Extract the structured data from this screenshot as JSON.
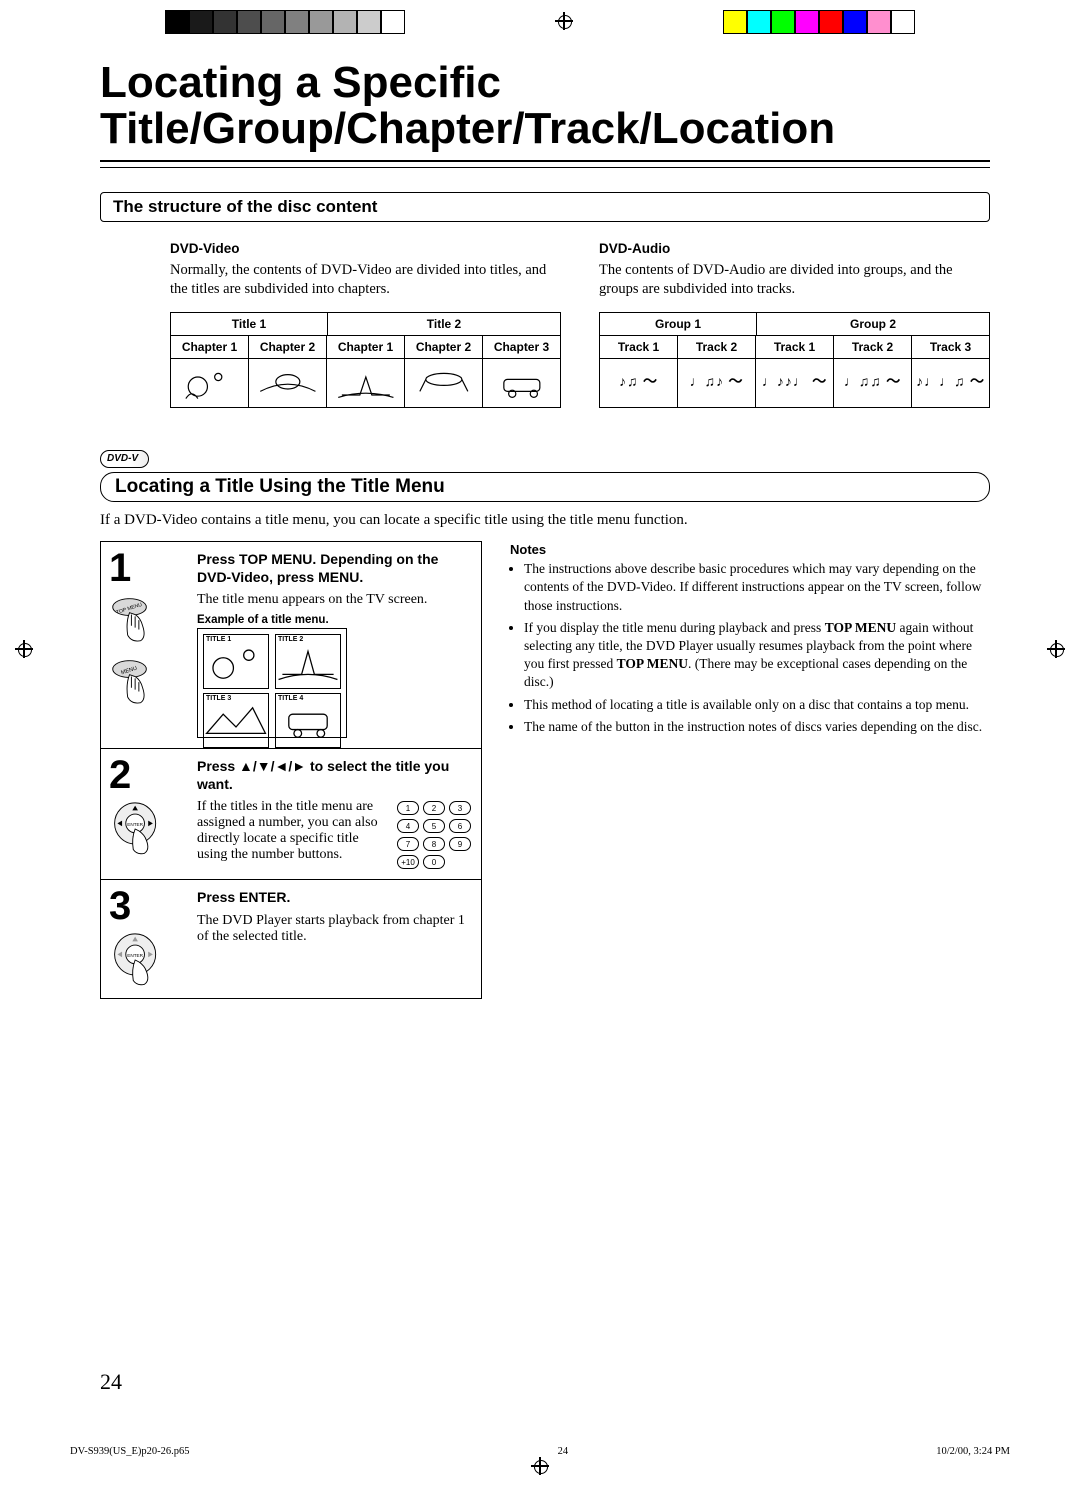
{
  "title": "Locating a Specific Title/Group/Chapter/Track/Location",
  "structure": {
    "heading": "The structure of the disc content",
    "video": {
      "label": "DVD-Video",
      "desc": "Normally, the contents of DVD-Video are divided into titles, and the titles are subdivided into chapters.",
      "titles": [
        "Title 1",
        "Title 2"
      ],
      "chapters": [
        "Chapter 1",
        "Chapter 2",
        "Chapter 1",
        "Chapter 2",
        "Chapter 3"
      ]
    },
    "audio": {
      "label": "DVD-Audio",
      "desc": "The contents of DVD-Audio are divided into groups, and the groups are subdivided into tracks.",
      "groups": [
        "Group 1",
        "Group 2"
      ],
      "tracks": [
        "Track 1",
        "Track 2",
        "Track 1",
        "Track 2",
        "Track 3"
      ]
    }
  },
  "badge": "DVD-V",
  "locating": {
    "heading": "Locating a Title Using the Title Menu",
    "intro": "If a DVD-Video contains a title menu, you can locate a specific title using the title menu function."
  },
  "steps": [
    {
      "num": "1",
      "instr": "Press TOP MENU. Depending on the DVD-Video, press MENU.",
      "expl": "The title menu appears on the TV screen.",
      "caption": "Example of a title menu.",
      "tv": [
        "TITLE 1",
        "TITLE 2",
        "TITLE 3",
        "TITLE 4"
      ],
      "btn1": "TOP MENU",
      "btn2": "MENU"
    },
    {
      "num": "2",
      "instr": "Press ▲/▼/◄/► to select the title you want.",
      "expl": "If the titles in the title menu are assigned a number, you can also directly locate a specific title using the number buttons.",
      "keypad": [
        "1",
        "2",
        "3",
        "4",
        "5",
        "6",
        "7",
        "8",
        "9",
        "+10",
        "0"
      ],
      "btn1": "ENTER"
    },
    {
      "num": "3",
      "instr": "Press ENTER.",
      "expl": "The DVD Player starts playback from chapter 1 of the selected title.",
      "btn1": "ENTER"
    }
  ],
  "notes": {
    "heading": "Notes",
    "items": [
      "The instructions above describe basic procedures which may vary depending on the contents of the DVD-Video. If different instructions appear on the TV screen, follow those instructions.",
      "If you display the title menu during playback and press <b>TOP MENU</b> again without selecting any title, the DVD Player usually resumes playback from the point where you first pressed <b>TOP MENU</b>. (There may be exceptional cases depending on the disc.)",
      "This method of locating a title is available only on a disc that contains a top menu.",
      "The name of the button in the instruction notes of discs varies depending on the disc."
    ]
  },
  "page_num": "24",
  "footer": {
    "file": "DV-S939(US_E)p20-26.p65",
    "pg": "24",
    "date": "10/2/00, 3:24 PM"
  },
  "colors_left": [
    "#000",
    "#1a1a1a",
    "#333",
    "#4d4d4d",
    "#666",
    "#808080",
    "#999",
    "#b3b3b3",
    "#ccc",
    "#fff"
  ],
  "colors_right": [
    "#ff0",
    "#0ff",
    "#0f0",
    "#f0f",
    "#f00",
    "#00f",
    "#ff8fcf",
    "#fff"
  ]
}
